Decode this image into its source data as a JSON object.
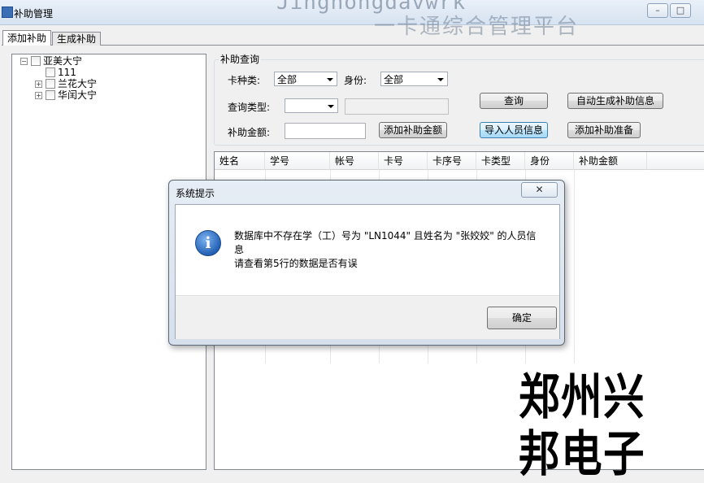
{
  "window": {
    "title": "补助管理",
    "watermark_line1": "Jinghongdavwrk",
    "watermark_line2": "一卡通综合管理平台"
  },
  "tabs": [
    {
      "label": "添加补助",
      "active": true
    },
    {
      "label": "生成补助",
      "active": false
    }
  ],
  "tree": {
    "root": "亚美大宁",
    "children": [
      {
        "label": "111",
        "expandable": false
      },
      {
        "label": "兰花大宁",
        "expandable": true
      },
      {
        "label": "华闰大宁",
        "expandable": true
      }
    ]
  },
  "query": {
    "group_title": "补助查询",
    "card_type_label": "卡种类:",
    "card_type_value": "全部",
    "identity_label": "身份:",
    "identity_value": "全部",
    "query_type_label": "查询类型:",
    "query_type_value": "",
    "amount_label": "补助金额:",
    "amount_value": "",
    "btn_add_amount": "添加补助金额",
    "btn_query": "查询",
    "btn_auto_generate": "自动生成补助信息",
    "btn_import": "导入人员信息",
    "btn_add_prepare": "添加补助准备"
  },
  "grid": {
    "columns": [
      "姓名",
      "学号",
      "帐号",
      "卡号",
      "卡序号",
      "卡类型",
      "身份",
      "补助金额"
    ]
  },
  "dialog": {
    "title": "系统提示",
    "close_glyph": "✕",
    "message_line1": "数据库中不存在学（工）号为 \"LN1044\" 且姓名为 \"张姣姣\" 的人员信",
    "message_line2": "息",
    "message_line3": "请查看第5行的数据是否有误",
    "ok_label": "确定",
    "icon": "info-icon"
  },
  "watermark_brand": "郑州兴邦电子",
  "colors": {
    "accent": "#3c7fb1",
    "info_icon": "#2361b5"
  }
}
